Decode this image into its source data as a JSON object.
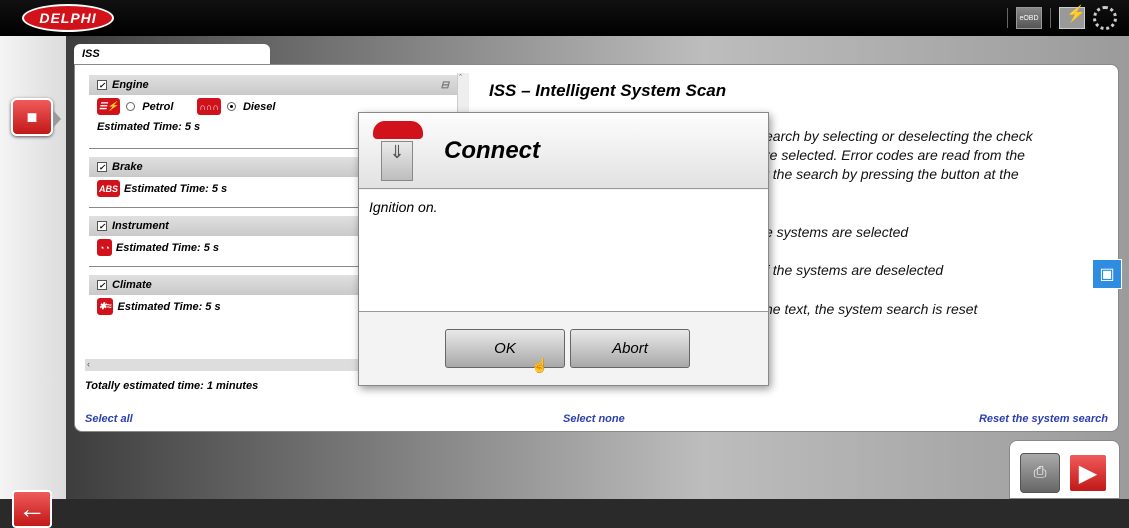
{
  "header": {
    "logo": "DELPHI",
    "eobd": "eOBD"
  },
  "tab": {
    "label": "ISS"
  },
  "systems": [
    {
      "name": "Engine",
      "time": "Estimated Time: 5 s",
      "opt1": "Petrol",
      "opt2": "Diesel"
    },
    {
      "name": "Brake",
      "icon": "ABS",
      "time": "Estimated Time: 5 s"
    },
    {
      "name": "Instrument",
      "time": "Estimated Time: 5 s"
    },
    {
      "name": "Climate",
      "time": "Estimated Time: 5 s"
    }
  ],
  "total": "Totally estimated time: 1 minutes",
  "links": {
    "select_all": "Select all",
    "select_none": "Select none",
    "reset": "Reset the system search"
  },
  "info": {
    "title": "ISS – Intelligent System Scan",
    "lines": [
      "earch by selecting or deselecting the check",
      "re selected. Error codes are read from the",
      "t the search by pressing the button at the",
      "e systems are selected",
      "f the systems are deselected",
      "he text, the system search is reset"
    ]
  },
  "dialog": {
    "title": "Connect",
    "message": "Ignition on.",
    "ok": "OK",
    "abort": "Abort"
  }
}
